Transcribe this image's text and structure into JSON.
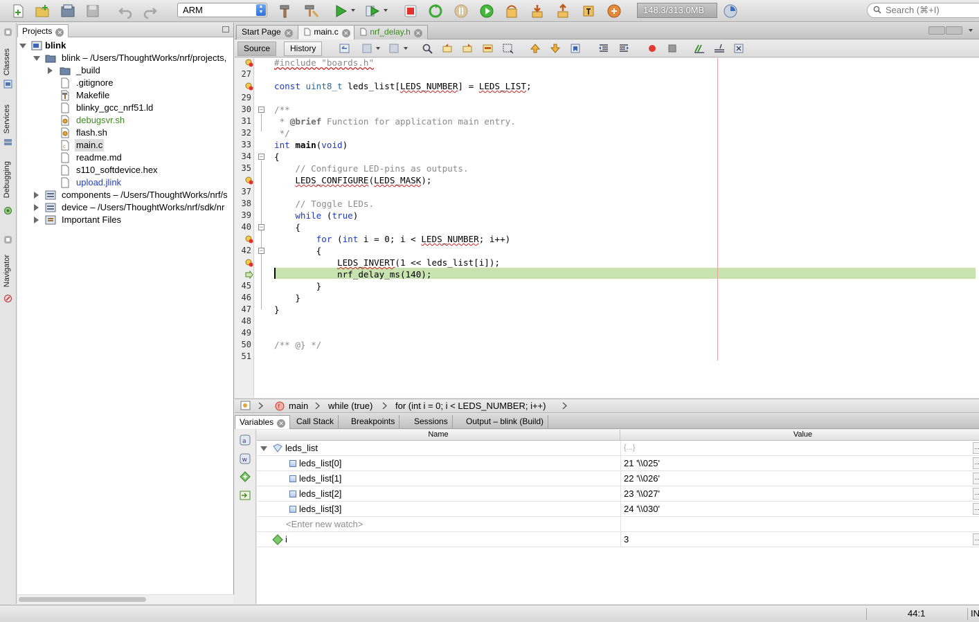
{
  "toolbar": {
    "configuration": "ARM",
    "memory": "148.3/313.0MB",
    "search_placeholder": "Search (⌘+I)"
  },
  "left_strip": {
    "items": [
      "Classes",
      "Services",
      "Debugging",
      "Navigator"
    ]
  },
  "projects": {
    "tab_label": "Projects",
    "tree": [
      {
        "label": "blink",
        "depth": 0,
        "expanded": true,
        "icon": "project-icon",
        "bold": true
      },
      {
        "label": "blink – /Users/ThoughtWorks/nrf/projects,",
        "depth": 1,
        "expanded": true,
        "icon": "folder-icon"
      },
      {
        "label": "_build",
        "depth": 2,
        "expanded": false,
        "icon": "folder-icon"
      },
      {
        "label": ".gitignore",
        "depth": 2,
        "icon": "file-icon"
      },
      {
        "label": "Makefile",
        "depth": 2,
        "icon": "makefile-icon"
      },
      {
        "label": "blinky_gcc_nrf51.ld",
        "depth": 2,
        "icon": "file-icon"
      },
      {
        "label": "debugsvr.sh",
        "depth": 2,
        "icon": "script-icon",
        "color": "#3c8a1e"
      },
      {
        "label": "flash.sh",
        "depth": 2,
        "icon": "script-icon"
      },
      {
        "label": "main.c",
        "depth": 2,
        "icon": "c-file-icon",
        "selected": true
      },
      {
        "label": "readme.md",
        "depth": 2,
        "icon": "file-icon"
      },
      {
        "label": "s110_softdevice.hex",
        "depth": 2,
        "icon": "file-icon"
      },
      {
        "label": "upload.jlink",
        "depth": 2,
        "icon": "file-icon",
        "color": "#1f3fd0"
      },
      {
        "label": "components – /Users/ThoughtWorks/nrf/s",
        "depth": 1,
        "expanded": false,
        "icon": "library-icon"
      },
      {
        "label": "device – /Users/ThoughtWorks/nrf/sdk/nr",
        "depth": 1,
        "expanded": false,
        "icon": "library-icon"
      },
      {
        "label": "Important Files",
        "depth": 1,
        "expanded": false,
        "icon": "important-files-icon"
      }
    ]
  },
  "editor": {
    "tabs": [
      {
        "label": "Start Page",
        "active": false
      },
      {
        "label": "main.c",
        "active": true
      },
      {
        "label": "nrf_delay.h",
        "active": false,
        "color": "#3c8a1e"
      }
    ],
    "source_label": "Source",
    "history_label": "History",
    "lines": [
      {
        "no": "",
        "code": "#include \"boards.h\""
      },
      {
        "no": "27",
        "code": ""
      },
      {
        "no": "",
        "code": "const uint8_t leds_list[LEDS_NUMBER] = LEDS_LIST;"
      },
      {
        "no": "29",
        "code": ""
      },
      {
        "no": "30",
        "code": "/**"
      },
      {
        "no": "31",
        "code": " * @brief Function for application main entry."
      },
      {
        "no": "32",
        "code": " */"
      },
      {
        "no": "33",
        "code": "int main(void)"
      },
      {
        "no": "34",
        "code": "{"
      },
      {
        "no": "35",
        "code": "    // Configure LED-pins as outputs."
      },
      {
        "no": "",
        "code": "    LEDS_CONFIGURE(LEDS_MASK);"
      },
      {
        "no": "37",
        "code": ""
      },
      {
        "no": "38",
        "code": "    // Toggle LEDs."
      },
      {
        "no": "39",
        "code": "    while (true)"
      },
      {
        "no": "40",
        "code": "    {"
      },
      {
        "no": "",
        "code": "        for (int i = 0; i < LEDS_NUMBER; i++)"
      },
      {
        "no": "42",
        "code": "        {"
      },
      {
        "no": "",
        "code": "            LEDS_INVERT(1 << leds_list[i]);"
      },
      {
        "no": "",
        "code": "            nrf_delay_ms(140);"
      },
      {
        "no": "45",
        "code": "        }"
      },
      {
        "no": "46",
        "code": "    }"
      },
      {
        "no": "47",
        "code": "}"
      },
      {
        "no": "48",
        "code": ""
      },
      {
        "no": "49",
        "code": ""
      },
      {
        "no": "50",
        "code": "/** @} */"
      },
      {
        "no": "51",
        "code": ""
      }
    ]
  },
  "breadcrumb": [
    "main",
    "while (true)",
    "for (int i = 0; i < LEDS_NUMBER; i++)"
  ],
  "bottom": {
    "tabs": [
      "Variables",
      "Call Stack",
      "Breakpoints",
      "Sessions",
      "Output – blink (Build)"
    ],
    "columns": {
      "name": "Name",
      "value": "Value"
    },
    "rows": [
      {
        "name": "leds_list",
        "value": "{...}"
      },
      {
        "name": "leds_list[0]",
        "value": "21 '\\\\025'"
      },
      {
        "name": "leds_list[1]",
        "value": "22 '\\\\026'"
      },
      {
        "name": "leds_list[2]",
        "value": "23 '\\\\027'"
      },
      {
        "name": "leds_list[3]",
        "value": "24 '\\\\030'"
      },
      {
        "name": "<Enter new watch>",
        "value": ""
      },
      {
        "name": "i",
        "value": "3"
      }
    ]
  },
  "status": {
    "position": "44:1",
    "mode": "IN"
  }
}
